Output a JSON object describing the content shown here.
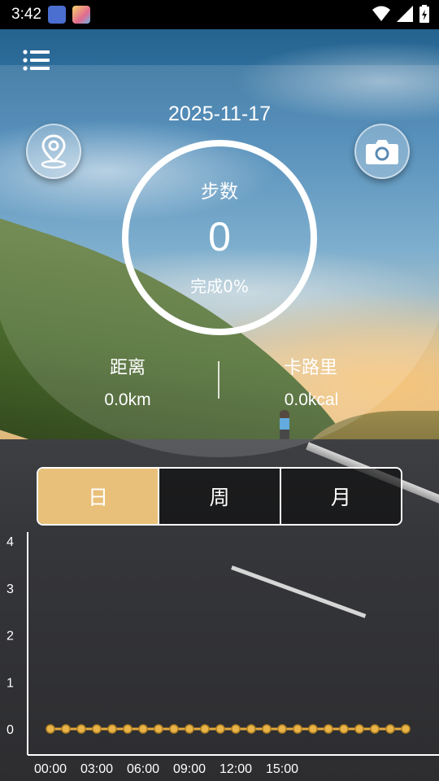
{
  "status_bar": {
    "time": "3:42",
    "icons": [
      "notification-app-icon",
      "notification-avatar-icon",
      "wifi-icon",
      "signal-icon",
      "battery-icon"
    ]
  },
  "header": {
    "menu_icon": "menu-list-icon",
    "location_icon": "location-pin-icon",
    "camera_icon": "camera-icon",
    "date": "2025-11-17"
  },
  "steps": {
    "label": "步数",
    "value": "0",
    "completion_text": "完成0%",
    "completion_percent": 0
  },
  "stats": {
    "distance_label": "距离",
    "distance_value": "0.0km",
    "calories_label": "卡路里",
    "calories_value": "0.0kcal"
  },
  "tabs": [
    {
      "label": "日",
      "active": true
    },
    {
      "label": "周",
      "active": false
    },
    {
      "label": "月",
      "active": false
    }
  ],
  "colors": {
    "accent": "#e9c079",
    "line": "#e3a93c"
  },
  "chart_data": {
    "type": "line",
    "title": "",
    "xlabel": "",
    "ylabel": "",
    "yticks": [
      "0",
      "1",
      "2",
      "3",
      "4"
    ],
    "ylim": [
      0,
      4
    ],
    "xtick_labels": [
      "00:00",
      "03:00",
      "06:00",
      "09:00",
      "12:00",
      "15:00"
    ],
    "x": [
      "00:00",
      "01:00",
      "02:00",
      "03:00",
      "04:00",
      "05:00",
      "06:00",
      "07:00",
      "08:00",
      "09:00",
      "10:00",
      "11:00",
      "12:00",
      "13:00",
      "14:00",
      "15:00",
      "16:00",
      "17:00",
      "18:00",
      "19:00",
      "20:00",
      "21:00",
      "22:00",
      "23:00"
    ],
    "values": [
      0,
      0,
      0,
      0,
      0,
      0,
      0,
      0,
      0,
      0,
      0,
      0,
      0,
      0,
      0,
      0,
      0,
      0,
      0,
      0,
      0,
      0,
      0,
      0
    ]
  }
}
